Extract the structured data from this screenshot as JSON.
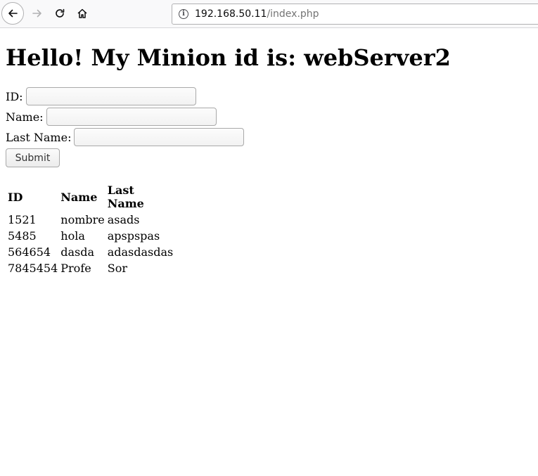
{
  "browser": {
    "url_host": "192.168.50.11",
    "url_path": "/index.php",
    "icons": [
      "back-arrow-icon",
      "forward-arrow-icon",
      "reload-icon",
      "home-icon",
      "info-icon"
    ]
  },
  "page": {
    "heading": "Hello! My Minion id is: webServer2"
  },
  "form": {
    "id_label": "ID:",
    "name_label": "Name:",
    "last_name_label": "Last Name:",
    "id_value": "",
    "name_value": "",
    "last_name_value": "",
    "submit_label": "Submit"
  },
  "table": {
    "headers": [
      "ID",
      "Name",
      "Last Name"
    ],
    "rows": [
      [
        "1521",
        "nombre",
        "asads"
      ],
      [
        "5485",
        "hola",
        "apspspas"
      ],
      [
        "564654",
        "dasda",
        "adasdasdas"
      ],
      [
        "7845454",
        "Profe",
        "Sor"
      ]
    ]
  }
}
